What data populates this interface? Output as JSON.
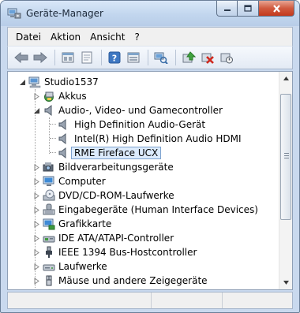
{
  "window": {
    "title": "Geräte-Manager",
    "icon": "device-manager-icon",
    "buttons": {
      "minimize": "minimize-icon",
      "maximize": "maximize-icon",
      "close": "close-icon"
    }
  },
  "menu": [
    {
      "label": "Datei"
    },
    {
      "label": "Aktion"
    },
    {
      "label": "Ansicht"
    },
    {
      "label": "?"
    }
  ],
  "toolbar": [
    {
      "icon": "back-arrow-icon"
    },
    {
      "icon": "forward-arrow-icon"
    },
    {
      "icon": "properties-view-icon"
    },
    {
      "icon": "document-icon"
    },
    {
      "icon": "help-icon"
    },
    {
      "icon": "show-hidden-icon"
    },
    {
      "icon": "scan-hardware-icon"
    },
    {
      "icon": "update-driver-icon"
    },
    {
      "icon": "uninstall-icon"
    },
    {
      "icon": "disable-device-icon"
    }
  ],
  "tree": {
    "root": {
      "label": "Studio1537",
      "icon": "computer-icon"
    },
    "items": [
      {
        "label": "Akkus",
        "icon": "battery-icon",
        "expanded": false
      },
      {
        "label": "Audio-, Video- und Gamecontroller",
        "icon": "speaker-icon",
        "expanded": true,
        "children": [
          {
            "label": "High Definition Audio-Gerät",
            "icon": "speaker-icon"
          },
          {
            "label": "Intel(R) High Definition Audio HDMI",
            "icon": "speaker-icon"
          },
          {
            "label": "RME Fireface UCX",
            "icon": "speaker-icon",
            "selected": true
          }
        ]
      },
      {
        "label": "Bildverarbeitungsgeräte",
        "icon": "camera-icon",
        "expanded": false
      },
      {
        "label": "Computer",
        "icon": "monitor-icon",
        "expanded": false
      },
      {
        "label": "DVD/CD-ROM-Laufwerke",
        "icon": "dvd-drive-icon",
        "expanded": false
      },
      {
        "label": "Eingabegeräte (Human Interface Devices)",
        "icon": "hid-icon",
        "expanded": false
      },
      {
        "label": "Grafikkarte",
        "icon": "display-adapter-icon",
        "expanded": false
      },
      {
        "label": "IDE ATA/ATAPI-Controller",
        "icon": "ide-controller-icon",
        "expanded": false
      },
      {
        "label": "IEEE 1394 Bus-Hostcontroller",
        "icon": "firewire-icon",
        "expanded": false
      },
      {
        "label": "Laufwerke",
        "icon": "disk-drive-icon",
        "expanded": false
      },
      {
        "label": "Mäuse und andere Zeigegeräte",
        "icon": "mouse-icon",
        "expanded": false
      }
    ]
  },
  "scrollbar": {
    "up": "scroll-up-icon",
    "down": "scroll-down-icon"
  },
  "colors": {
    "selection_bg": "#dcebfc",
    "selection_border": "#7da2ce",
    "close_button": "#c4391c"
  }
}
